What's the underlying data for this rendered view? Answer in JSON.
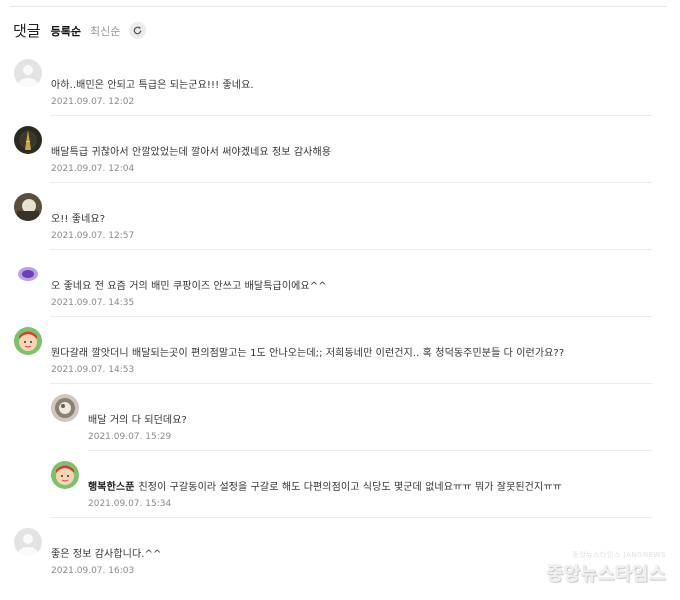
{
  "header": {
    "title": "댓글",
    "sort_registered": "등록순",
    "sort_newest": "최신순",
    "refresh_icon": "refresh-icon"
  },
  "comments": [
    {
      "avatar": "default-avatar",
      "text": "아하..배민은 안되고 특급은 되는군요!!! 좋네요.",
      "date": "2021.09.07. 12:02"
    },
    {
      "avatar": "tower-night-avatar",
      "text": "배달특급 귀찮아서 안깔았었는데 깔아서 써야겠네요 정보 감사해용",
      "date": "2021.09.07. 12:04"
    },
    {
      "avatar": "photo-avatar",
      "text": "오!! 좋네요?",
      "date": "2021.09.07. 12:57"
    },
    {
      "avatar": "purple-blob-avatar",
      "text": "오 좋네요 전 요즘 거의 배민 쿠팡이즈 안쓰고 배달특급이에요^^",
      "date": "2021.09.07. 14:35"
    },
    {
      "avatar": "cartoon-face-avatar",
      "text": "뭔다갈래 깔앗더니 배달되는곳이 편의점말고는 1도 안나오는데;; 저희동네만 이런건지.. 혹 청덕동주민분들 다 이런가요??",
      "date": "2021.09.07. 14:53"
    }
  ],
  "replies": [
    {
      "avatar": "photo-avatar-2",
      "text": "배달 거의 다 되던데요?",
      "date": "2021.09.07. 15:29"
    },
    {
      "avatar": "cartoon-face-avatar",
      "author": "행복한스푼",
      "text": "친정이 구갈동이라 설정을 구갈로 해도 다편의점이고 식당도 몇군데 없네요ㅠㅠ 뭐가 잘못된건지ㅠㅠ",
      "date": "2021.09.07. 15:34"
    }
  ],
  "last_comment": {
    "avatar": "default-avatar",
    "text": "좋은 정보 감사합니다.^^",
    "date": "2021.09.07. 16:03"
  },
  "watermark": {
    "small": "중앙뉴스타임스 JANGNEWS",
    "big": "중앙뉴스타임스"
  }
}
